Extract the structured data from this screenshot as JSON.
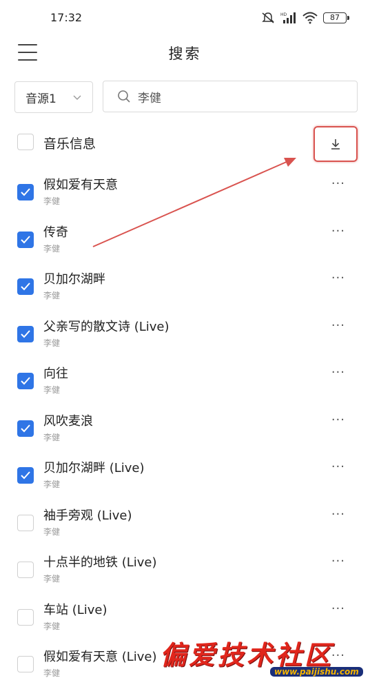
{
  "status_bar": {
    "time": "17:32",
    "battery": "87",
    "icons": [
      "mute-icon",
      "hd-signal-icon",
      "wifi-icon",
      "battery-icon"
    ]
  },
  "header": {
    "title": "搜索",
    "menu_icon": "hamburger-menu-icon"
  },
  "search": {
    "source": "音源1",
    "query": "李健"
  },
  "list_header": {
    "label": "音乐信息",
    "select_all_checked": false,
    "download_icon": "download-icon"
  },
  "colors": {
    "checkbox_checked": "#2f75e6",
    "annotation": "#d9534f"
  },
  "songs": [
    {
      "title": "假如爱有天意",
      "artist": "李健",
      "checked": true
    },
    {
      "title": "传奇",
      "artist": "李健",
      "checked": true
    },
    {
      "title": "贝加尔湖畔",
      "artist": "李健",
      "checked": true
    },
    {
      "title": "父亲写的散文诗 (Live)",
      "artist": "李健",
      "checked": true
    },
    {
      "title": "向往",
      "artist": "李健",
      "checked": true
    },
    {
      "title": "风吹麦浪",
      "artist": "李健",
      "checked": true
    },
    {
      "title": "贝加尔湖畔 (Live)",
      "artist": "李健",
      "checked": true
    },
    {
      "title": "袖手旁观 (Live)",
      "artist": "李健",
      "checked": false
    },
    {
      "title": "十点半的地铁 (Live)",
      "artist": "李健",
      "checked": false
    },
    {
      "title": "车站 (Live)",
      "artist": "李健",
      "checked": false
    },
    {
      "title": "假如爱有天意 (Live)",
      "artist": "李健",
      "checked": false
    }
  ],
  "more_label": "···",
  "watermark": {
    "title": "偏爱技术社区",
    "url": "www.paijishu.com"
  }
}
